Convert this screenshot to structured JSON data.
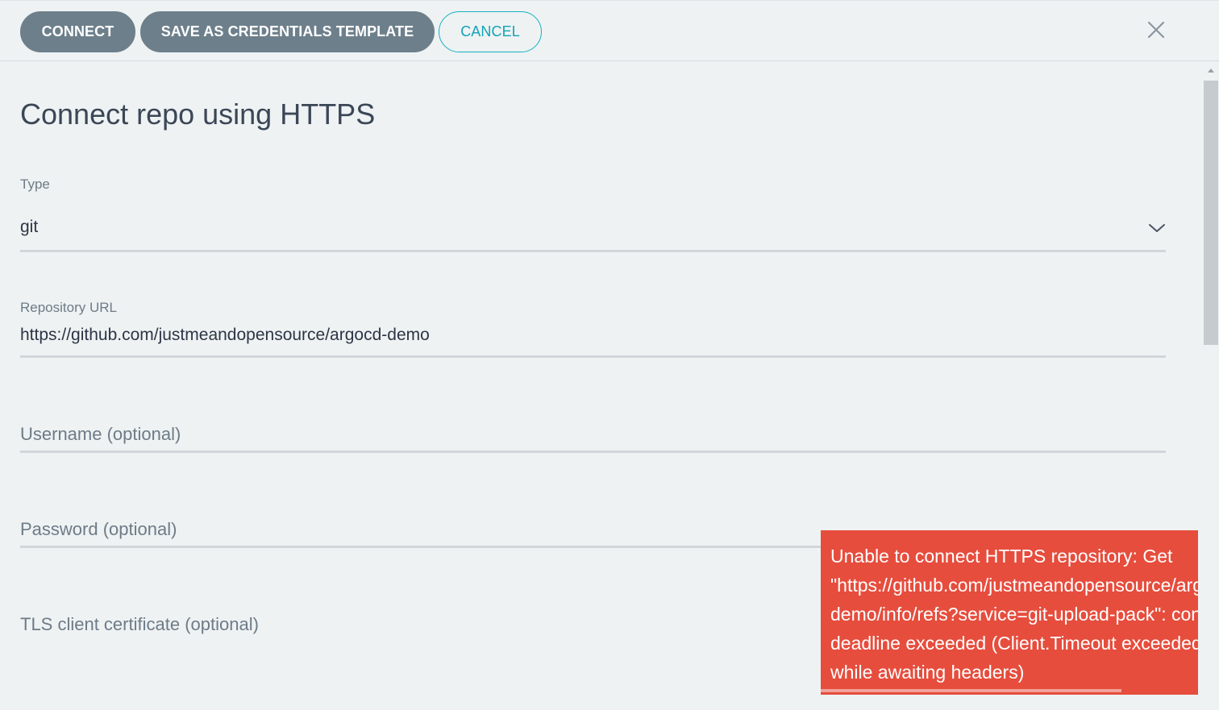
{
  "toolbar": {
    "connect_label": "CONNECT",
    "save_template_label": "SAVE AS CREDENTIALS TEMPLATE",
    "cancel_label": "CANCEL"
  },
  "form": {
    "title": "Connect repo using HTTPS",
    "type": {
      "label": "Type",
      "value": "git"
    },
    "repo_url": {
      "label": "Repository URL",
      "value": "https://github.com/justmeandopensource/argocd-demo"
    },
    "username": {
      "placeholder": "Username (optional)"
    },
    "password": {
      "placeholder": "Password (optional)"
    },
    "tls_cert": {
      "placeholder": "TLS client certificate (optional)"
    }
  },
  "toast": {
    "lines": [
      "Unable to connect HTTPS repository: Get",
      "\"https://github.com/justmeandopensource/argocd-",
      "demo/info/refs?service=git-upload-pack\": context",
      "deadline exceeded (Client.Timeout exceeded",
      "while awaiting headers)"
    ]
  },
  "colors": {
    "primary_button": "#6d7f8b",
    "accent": "#16b1c2",
    "error": "#e64d3d",
    "background": "#eef2f3"
  }
}
